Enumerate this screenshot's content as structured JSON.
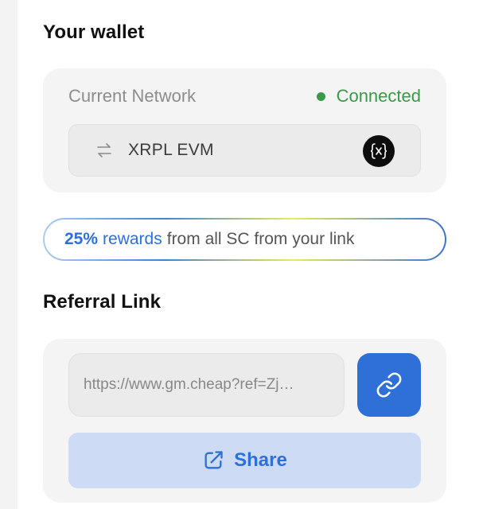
{
  "wallet": {
    "title": "Your wallet",
    "network_label": "Current Network",
    "status": "Connected",
    "status_color": "#3a9a48",
    "network_name": "XRPL EVM",
    "network_icon": "swap-arrows-icon",
    "network_logo": "xrpl-evm-logo"
  },
  "rewards": {
    "percent": "25%",
    "word": "rewards",
    "rest": "from all SC from your link"
  },
  "referral": {
    "title": "Referral Link",
    "link_value": "https://www.gm.cheap?ref=Zj…",
    "copy_icon": "link-icon",
    "share_label": "Share",
    "share_icon": "external-share-icon"
  },
  "colors": {
    "accent": "#2f6fd8",
    "share_bg": "#cddcf4",
    "card_bg": "#f4f4f5"
  }
}
